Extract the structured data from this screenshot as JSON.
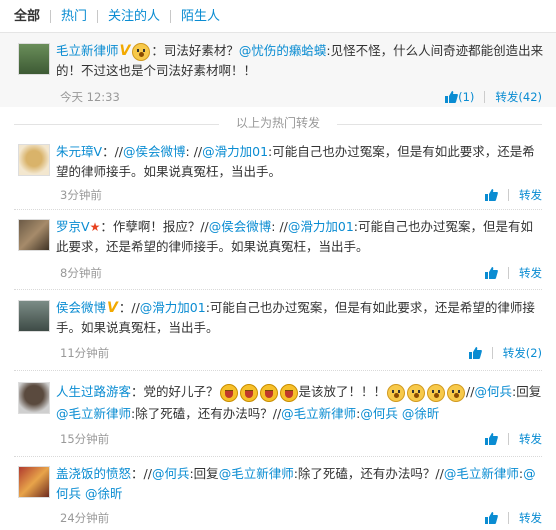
{
  "tabs": [
    "全部",
    "热门",
    "关注的人",
    "陌生人"
  ],
  "hot_item": {
    "name": "毛立新律师",
    "text_pre": "：司法好素材？",
    "at": "@忧伤的癞蛤蟆",
    "text_post": ":见怪不怪，什么人间奇迹都能创造出来的！不过这也是个司法好素材啊！！",
    "time": "今天 12:33",
    "like_label": "(1)",
    "repost_label": "转发(42)"
  },
  "hot_divider": "以上为热门转发",
  "items": [
    {
      "name": "朱元璋V",
      "p1": "：//",
      "a1": "@侯会微博",
      "p2": ": //",
      "a2": "@滑力加01",
      "p3": ":可能自己也办过冤案，但是有如此要求，还是希望的律师接手。如果说真冤枉，当出手。",
      "time": "3分钟前",
      "repost_label": "转发"
    },
    {
      "name": "罗京V",
      "p1": "：作孽啊！报应？//",
      "a1": "@侯会微博",
      "p2": ": //",
      "a2": "@滑力加01",
      "p3": ":可能自己也办过冤案，但是有如此要求，还是希望的律师接手。如果说真冤枉，当出手。",
      "time": "8分钟前",
      "repost_label": "转发"
    },
    {
      "name": "侯会微博",
      "p1": "：//",
      "a1": "@滑力加01",
      "p2": ":可能自己也办过冤案，但是有如此要求，还是希望的律师接手。如果说真冤枉，当出手。",
      "time": "11分钟前",
      "repost_label": "转发(2)"
    },
    {
      "name": "人生过路游客",
      "p1": "：党的好儿子？",
      "p2": "是该放了！！！",
      "p3": "//",
      "a1": "@何兵",
      "p4": ":回复",
      "a2": "@毛立新律师",
      "p5": ":除了死磕，还有办法吗？//",
      "a3": "@毛立新律师",
      "p6": ":",
      "a4": "@何兵",
      "a5": "@徐昕",
      "time": "15分钟前",
      "repost_label": "转发"
    },
    {
      "name": "盖浇饭的愤怒",
      "p1": "：//",
      "a1": "@何兵",
      "p2": ":回复",
      "a2": "@毛立新律师",
      "p3": ":除了死磕，还有办法吗？//",
      "a3": "@毛立新律师",
      "p4": ":",
      "a4": "@何兵",
      "a5": "@徐昕",
      "time": "24分钟前",
      "repost_label": "转发"
    }
  ],
  "colors": {
    "link": "#0a8cd2",
    "meta": "#999999",
    "hot_bg": "#f7f7f7",
    "verified": "#f2a900"
  }
}
